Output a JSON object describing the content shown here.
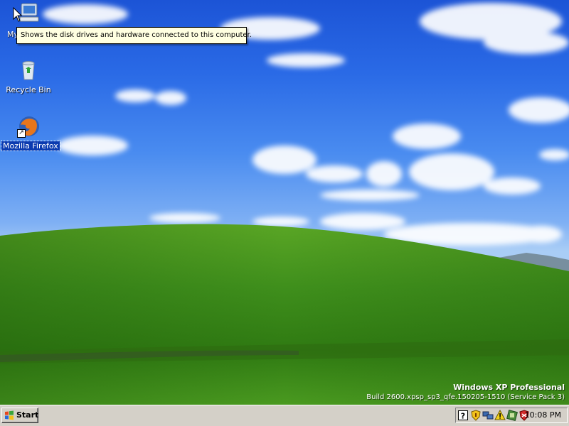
{
  "desktop": {
    "icons": [
      {
        "name": "my-computer",
        "label": "My Computer",
        "visible_label": "My"
      },
      {
        "name": "recycle-bin",
        "label": "Recycle Bin"
      },
      {
        "name": "mozilla-firefox",
        "label": "Mozilla Firefox",
        "icon": "firefox-icon"
      }
    ],
    "tooltip": "Shows the disk drives and hardware connected to this computer.",
    "watermark": {
      "edition": "Windows XP Professional",
      "build": "Build 2600.xpsp_sp3_qfe.150205-1510 (Service Pack 3)"
    }
  },
  "taskbar": {
    "start_label": "Start",
    "tray_icons": [
      "help-icon",
      "security-shield-icon",
      "network-icon",
      "warning-icon",
      "green-app-icon",
      "red-shield-icon"
    ],
    "clock": "10:08 PM"
  },
  "colors": {
    "sky_top": "#1c54d6",
    "hill_green": "#3f8f1c",
    "taskbar": "#d4d0c8",
    "tooltip_bg": "#ffffe1",
    "selection": "#0b3bb0"
  }
}
